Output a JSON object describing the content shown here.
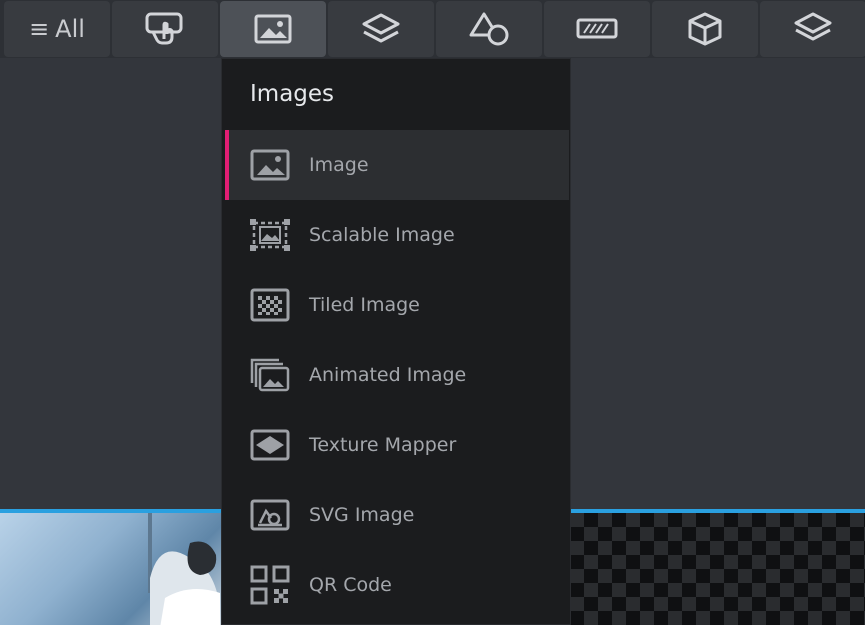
{
  "toolbar": {
    "all_label": "All",
    "buttons": [
      {
        "icon": "menu-icon"
      },
      {
        "icon": "touch-input-icon"
      },
      {
        "icon": "image-icon"
      },
      {
        "icon": "layers-icon"
      },
      {
        "icon": "shapes-icon"
      },
      {
        "icon": "progress-bar-icon"
      },
      {
        "icon": "cube-icon"
      },
      {
        "icon": "layers-alt-icon"
      }
    ]
  },
  "dropdown": {
    "title": "Images",
    "items": [
      {
        "label": "Image",
        "icon": "image-icon",
        "selected": true
      },
      {
        "label": "Scalable Image",
        "icon": "scalable-image-icon"
      },
      {
        "label": "Tiled Image",
        "icon": "tiled-image-icon"
      },
      {
        "label": "Animated Image",
        "icon": "animated-image-icon"
      },
      {
        "label": "Texture Mapper",
        "icon": "texture-mapper-icon"
      },
      {
        "label": "SVG Image",
        "icon": "svg-image-icon"
      },
      {
        "label": "QR Code",
        "icon": "qr-code-icon"
      }
    ]
  },
  "colors": {
    "accent": "#e21e74",
    "highlight_line": "#2aa0e0",
    "background": "#33363c",
    "menu_background": "#1b1c1e"
  }
}
